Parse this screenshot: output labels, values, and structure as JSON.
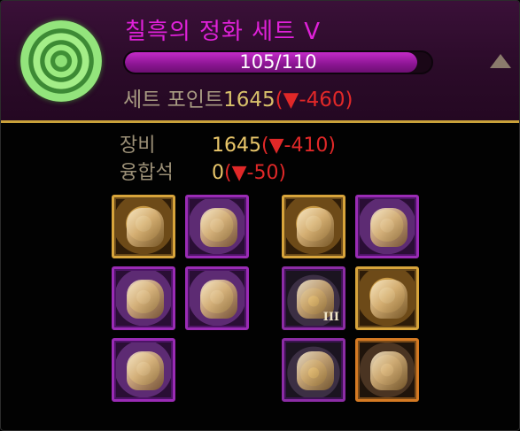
{
  "set": {
    "title": "칠흑의 정화 세트 V",
    "progress_text": "105/110",
    "progress": 0.9545,
    "set_point_label": "세트 포인트",
    "set_point_value": "1645",
    "set_point_change": "(▼-460)"
  },
  "stats": {
    "equipment_label": "장비",
    "equipment_value": "1645",
    "equipment_change": "(▼-410)",
    "fusion_label": "융합석",
    "fusion_value": "0",
    "fusion_change": "(▼-50)"
  },
  "colors": {
    "title": "#e021d9",
    "bar_fill": "#a020a8",
    "decrease": "#e02828",
    "value": "#e9c66a"
  },
  "slots": [
    {
      "name": "shoulder-slot",
      "frame": "gold"
    },
    {
      "name": "top-slot",
      "frame": "purple"
    },
    {
      "name": "bottom-slot",
      "frame": "purple"
    },
    {
      "name": "belt-slot",
      "frame": "purple"
    },
    {
      "name": "shoes-slot",
      "frame": "purple"
    },
    {
      "name": "bracelet-slot",
      "frame": "gold"
    },
    {
      "name": "necklace-slot",
      "frame": "purple"
    },
    {
      "name": "support-slot",
      "frame": "dark",
      "tier": "III"
    },
    {
      "name": "ring-slot",
      "frame": "gold"
    },
    {
      "name": "magic-stone-slot",
      "frame": "dark"
    },
    {
      "name": "earring-slot",
      "frame": "orange"
    }
  ]
}
